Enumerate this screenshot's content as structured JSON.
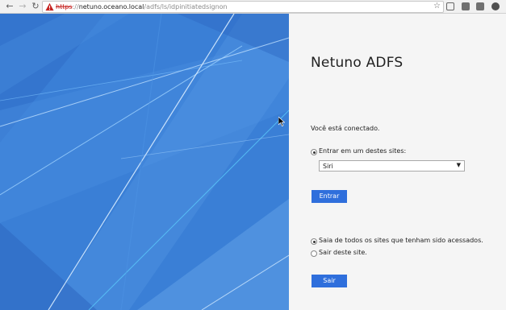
{
  "browser": {
    "url_scheme": "https",
    "url_sep": "://",
    "url_host": "netuno.oceano.local",
    "url_path": "/adfs/ls/idpinitiatedsignon",
    "icons": [
      "back-icon",
      "forward-icon",
      "reload-icon",
      "warning-icon",
      "star-icon",
      "cast-icon",
      "extension-icon"
    ]
  },
  "page": {
    "title": "Netuno ADFS",
    "connected_text": "Você está conectado.",
    "signin_option_label": "Entrar em um destes sites:",
    "site_select_value": "Siri",
    "signin_button": "Entrar",
    "signout_all_label": "Saia de todos os sites que tenham sido acessados.",
    "signout_this_label": "Sair deste site.",
    "signout_button": "Sair"
  },
  "colors": {
    "illustration_bg": "#3a7fd6",
    "button_bg": "#2f6fdc",
    "content_bg": "#f5f5f5",
    "url_warning": "#c5221f"
  }
}
